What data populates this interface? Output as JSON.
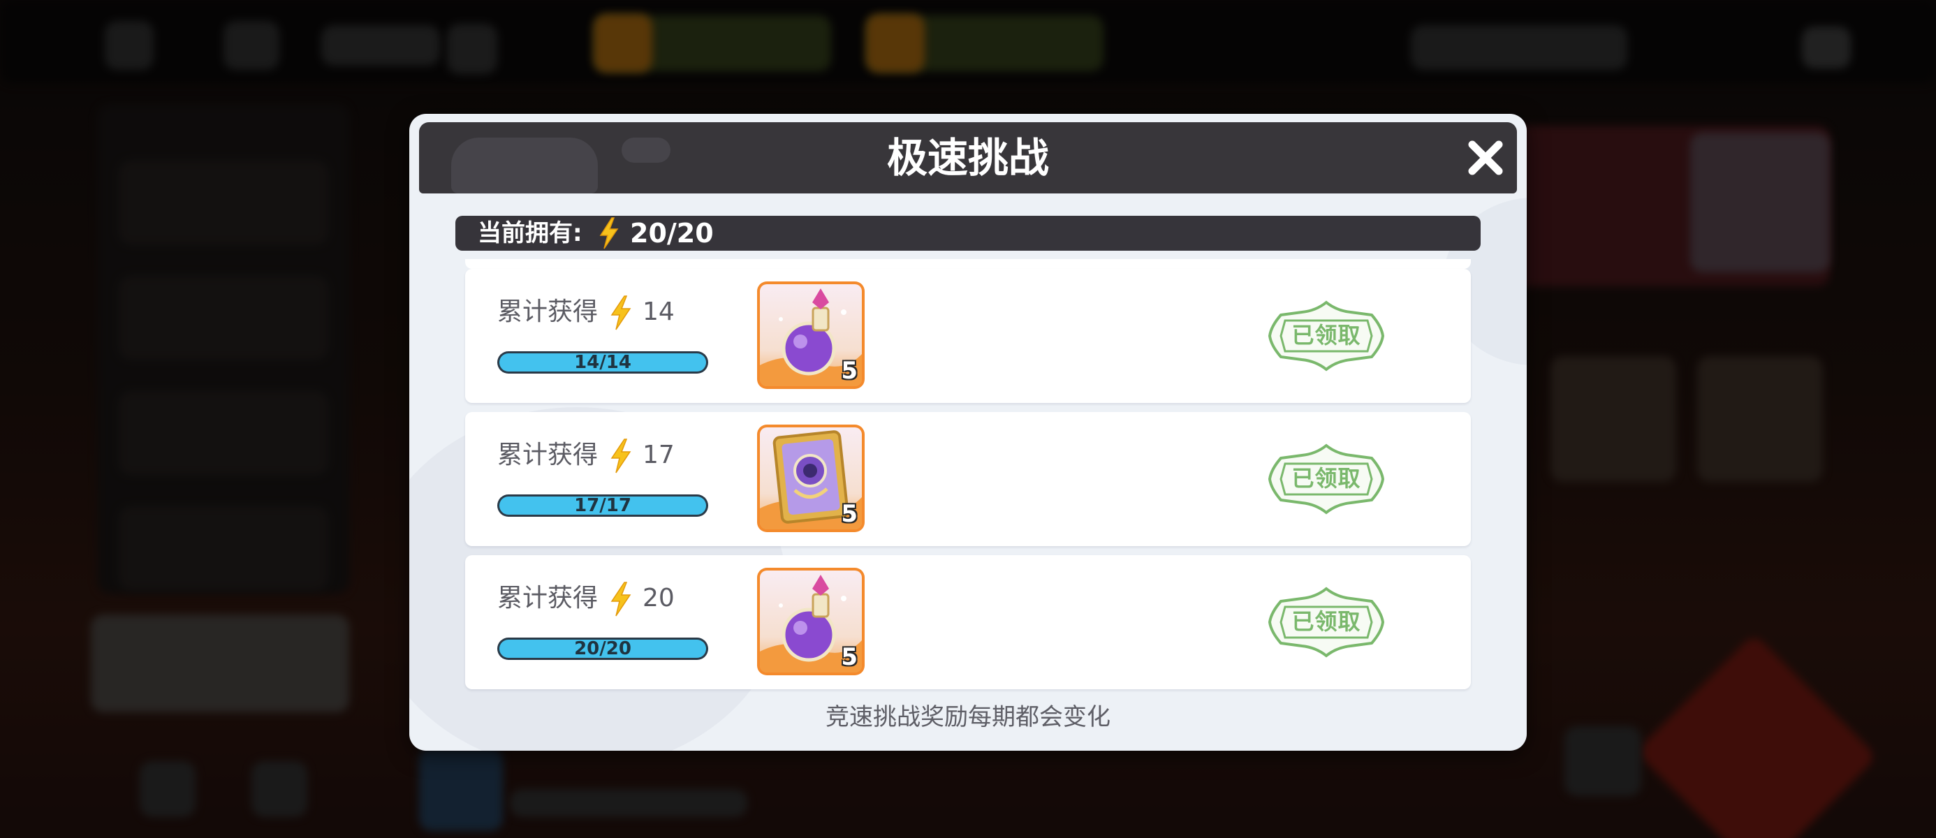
{
  "modal": {
    "title": "极速挑战",
    "owned_label": "当前拥有:",
    "owned_value": "20/20",
    "footer_note": "竞速挑战奖励每期都会变化"
  },
  "rows": [
    {
      "label": "累计获得",
      "target": "14",
      "progress_text": "14/14",
      "progress_fraction": 1.0,
      "reward_icon": "potion-icon",
      "reward_count": "5",
      "status": "已领取"
    },
    {
      "label": "累计获得",
      "target": "17",
      "progress_text": "17/17",
      "progress_fraction": 1.0,
      "reward_icon": "card-icon",
      "reward_count": "5",
      "status": "已领取"
    },
    {
      "label": "累计获得",
      "target": "20",
      "progress_text": "20/20",
      "progress_fraction": 1.0,
      "reward_icon": "potion-icon",
      "reward_count": "5",
      "status": "已领取"
    }
  ],
  "colors": {
    "header_bg": "#38363a",
    "panel_bg": "#edf1f6",
    "progress_fill": "#43c2ee",
    "stamp_green": "#7ab86c",
    "item_frame": "#f48a2c",
    "bolt": "#f7c21c"
  }
}
